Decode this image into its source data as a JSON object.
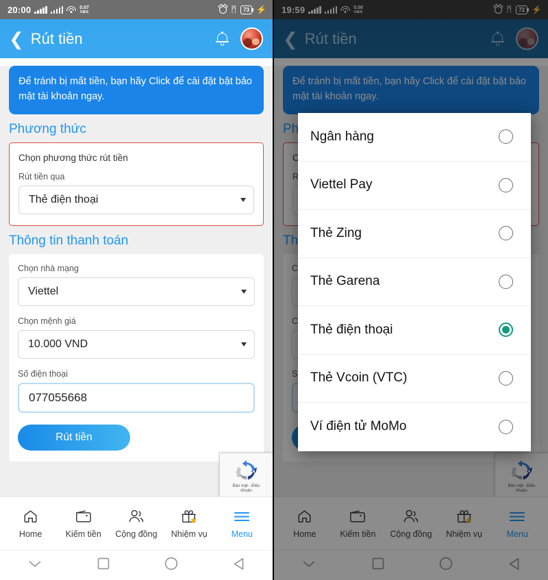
{
  "screens": [
    {
      "id": "left",
      "statusbar": {
        "time": "20:00",
        "net_speed_value": "0.07",
        "net_speed_unit": "KB/S",
        "battery": "73",
        "alarm_icon": "alarm-clock-icon",
        "bluetooth_icon": "bluetooth-icon",
        "charging_icon": "charging-bolt-icon",
        "wifi_icon": "wifi-icon",
        "signal_icon": "signal-bars-icon"
      },
      "appbar": {
        "back_icon": "back-chevron-icon",
        "title": "Rút tiền",
        "bell_icon": "bell-icon",
        "avatar_icon": "user-avatar"
      },
      "notice": "Để tránh bị mất tiền, bạn hãy Click để cài đặt bật bảo mật tài khoản ngay.",
      "method_section": {
        "title": "Phương thức",
        "card_head": "Chọn phương thức rút tiền",
        "field_label": "Rút tiền qua",
        "selected_value": "Thẻ điện thoại",
        "caret_icon": "chevron-down-icon"
      },
      "payment_section": {
        "title": "Thông tin thanh toán",
        "carrier_label": "Chọn nhà mạng",
        "carrier_value": "Viettel",
        "denom_label": "Chọn mệnh giá",
        "denom_value": "10.000 VND",
        "phone_label": "Số điện thoại",
        "phone_value": "077055668",
        "submit_label": "Rút tiền"
      },
      "recaptcha": {
        "caption_line1": "Bảo mật - Điều",
        "caption_line2": "khoản",
        "icon": "recaptcha-icon"
      },
      "bottomnav": [
        {
          "label": "Home",
          "icon": "home-icon",
          "active": false
        },
        {
          "label": "Kiếm tiền",
          "icon": "wallet-icon",
          "active": false
        },
        {
          "label": "Cộng đồng",
          "icon": "community-icon",
          "active": false
        },
        {
          "label": "Nhiệm vụ",
          "icon": "gift-icon",
          "active": false
        },
        {
          "label": "Menu",
          "icon": "hamburger-icon",
          "active": true
        }
      ],
      "androidnav": [
        {
          "icon": "chevron-down-icon"
        },
        {
          "icon": "recents-square-icon"
        },
        {
          "icon": "home-circle-icon"
        },
        {
          "icon": "back-triangle-icon"
        }
      ],
      "modal_open": false
    },
    {
      "id": "right",
      "statusbar": {
        "time": "19:59",
        "net_speed_value": "0.08",
        "net_speed_unit": "KB/S",
        "battery": "72",
        "alarm_icon": "alarm-clock-icon",
        "bluetooth_icon": "bluetooth-icon",
        "charging_icon": "charging-bolt-icon",
        "wifi_icon": "wifi-icon",
        "signal_icon": "signal-bars-icon"
      },
      "appbar": {
        "back_icon": "back-chevron-icon",
        "title": "Rút tiền",
        "bell_icon": "bell-icon",
        "avatar_icon": "user-avatar"
      },
      "notice": "Để tránh bị mất tiền, bạn hãy Click để cài đặt bật bảo mật tài khoản ngay.",
      "method_section": {
        "title": "Phương thức",
        "card_head": "Chọn phương thức rút tiền",
        "field_label": "Rút tiền qua",
        "selected_value": "Thẻ điện thoại",
        "caret_icon": "chevron-down-icon"
      },
      "payment_section": {
        "title": "Thông tin thanh toán",
        "carrier_label": "Chọn nhà mạng",
        "carrier_value": "Viettel",
        "denom_label": "Chọn mệnh giá",
        "denom_value": "10.000 VND",
        "phone_label": "Số điện thoại",
        "phone_value": "077055668",
        "submit_label": "Rút tiền"
      },
      "recaptcha": {
        "caption_line1": "Bảo mật - Điều",
        "caption_line2": "khoản",
        "icon": "recaptcha-icon"
      },
      "bottomnav": [
        {
          "label": "Home",
          "icon": "home-icon",
          "active": false
        },
        {
          "label": "Kiếm tiền",
          "icon": "wallet-icon",
          "active": false
        },
        {
          "label": "Cộng đồng",
          "icon": "community-icon",
          "active": false
        },
        {
          "label": "Nhiệm vụ",
          "icon": "gift-icon",
          "active": false
        },
        {
          "label": "Menu",
          "icon": "hamburger-icon",
          "active": true
        }
      ],
      "androidnav": [
        {
          "icon": "chevron-down-icon"
        },
        {
          "icon": "recents-square-icon"
        },
        {
          "icon": "home-circle-icon"
        },
        {
          "icon": "back-triangle-icon"
        }
      ],
      "modal_open": true
    }
  ],
  "modal": {
    "options": [
      {
        "label": "Ngân hàng",
        "selected": false
      },
      {
        "label": "Viettel Pay",
        "selected": false
      },
      {
        "label": "Thẻ Zing",
        "selected": false
      },
      {
        "label": "Thẻ Garena",
        "selected": false
      },
      {
        "label": "Thẻ điện thoại",
        "selected": true
      },
      {
        "label": "Thẻ Vcoin (VTC)",
        "selected": false
      },
      {
        "label": "Ví điện tử MoMo",
        "selected": false
      }
    ]
  },
  "colors": {
    "appbar_blue": "#39a8f0",
    "accent_blue": "#2196f3",
    "notice_blue": "#1a84e8",
    "radio_selected_green": "#0f9b7e",
    "outline_red": "#e14949",
    "statusbar_grey": "#6e6e6e"
  }
}
